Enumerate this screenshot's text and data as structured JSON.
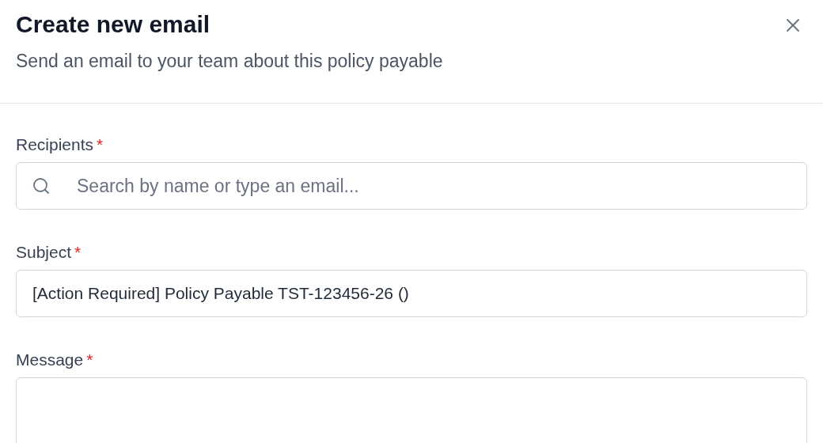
{
  "dialog": {
    "title": "Create new email",
    "subtitle": "Send an email to your team about this policy payable"
  },
  "fields": [
    {
      "kind": "search",
      "label": "Recipients",
      "required_mark": "*",
      "placeholder": "Search by name or type an email..."
    },
    {
      "kind": "text",
      "label": "Subject",
      "required_mark": "*",
      "value": "[Action Required] Policy Payable TST-123456-26 ()"
    },
    {
      "kind": "textarea",
      "label": "Message",
      "required_mark": "*"
    }
  ]
}
